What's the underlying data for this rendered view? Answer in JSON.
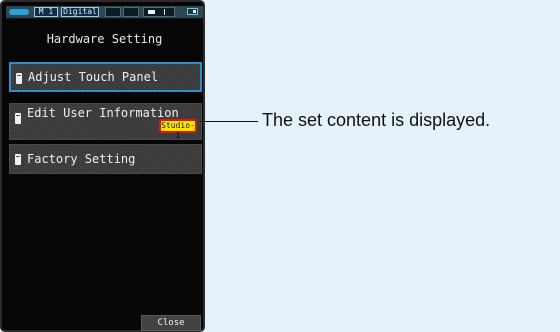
{
  "status_bar": {
    "mode": "M 1",
    "output": "Digital",
    "icons": [
      "battery-icon",
      "level-indicator-icon",
      "mini-battery-icon"
    ]
  },
  "screen": {
    "title": "Hardware Setting",
    "menu": {
      "adjust_touch_panel": "Adjust Touch Panel",
      "edit_user_information": "Edit User Information",
      "edit_user_value": "Studio-1",
      "factory_setting": "Factory Setting"
    },
    "close_label": "Close"
  },
  "callout": {
    "text": "The set content is displayed."
  },
  "colors": {
    "accent_blue": "#2a90cc",
    "badge_yellow": "#ffe600",
    "badge_border_red": "#e01515"
  }
}
